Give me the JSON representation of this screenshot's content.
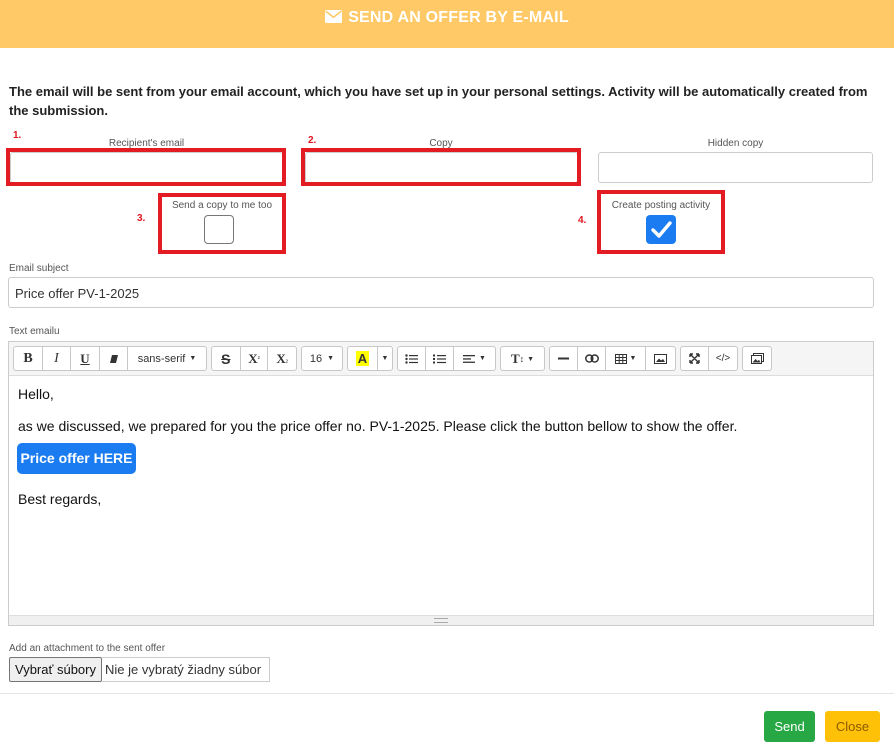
{
  "header": {
    "title": "SEND AN OFFER BY E-MAIL",
    "icon": "envelope-icon",
    "color": "#fec966"
  },
  "intro": "The email will be sent from your email account, which you have set up in your personal settings. Activity will be automatically created from the submission.",
  "annotations": {
    "n1": "1.",
    "n2": "2.",
    "n3": "3.",
    "n4": "4.",
    "highlight_color": "#e31b23"
  },
  "fields": {
    "recipient_label": "Recipient's email",
    "recipient_value": "",
    "copy_label": "Copy",
    "copy_value": "",
    "hidden_copy_label": "Hidden copy",
    "hidden_copy_value": "",
    "send_copy_label": "Send a copy to me too",
    "send_copy_checked": false,
    "posting_label": "Create posting activity",
    "posting_checked": true,
    "subject_label": "Email subject",
    "subject_value": "Price offer PV-1-2025",
    "text_label": "Text emailu"
  },
  "toolbar": {
    "bold": "B",
    "italic": "I",
    "underline": "U",
    "font_name": "sans-serif",
    "strike": "S",
    "superscript": "X",
    "subscript": "X",
    "font_size": "16",
    "color_letter": "A",
    "text_height": "T"
  },
  "editor": {
    "greeting": "Hello,",
    "body": "as we discussed, we prepared for you the price offer no. PV-1-2025. Please click the button bellow to show the offer.",
    "button": "Price offer HERE",
    "closing": "Best regards,"
  },
  "attachment": {
    "label": "Add an attachment to the sent offer",
    "button": "Vybrať súbory",
    "status": "Nie je vybratý žiadny súbor"
  },
  "actions": {
    "send": "Send",
    "close": "Close",
    "send_color": "#28a745",
    "close_color": "#ffc107"
  }
}
